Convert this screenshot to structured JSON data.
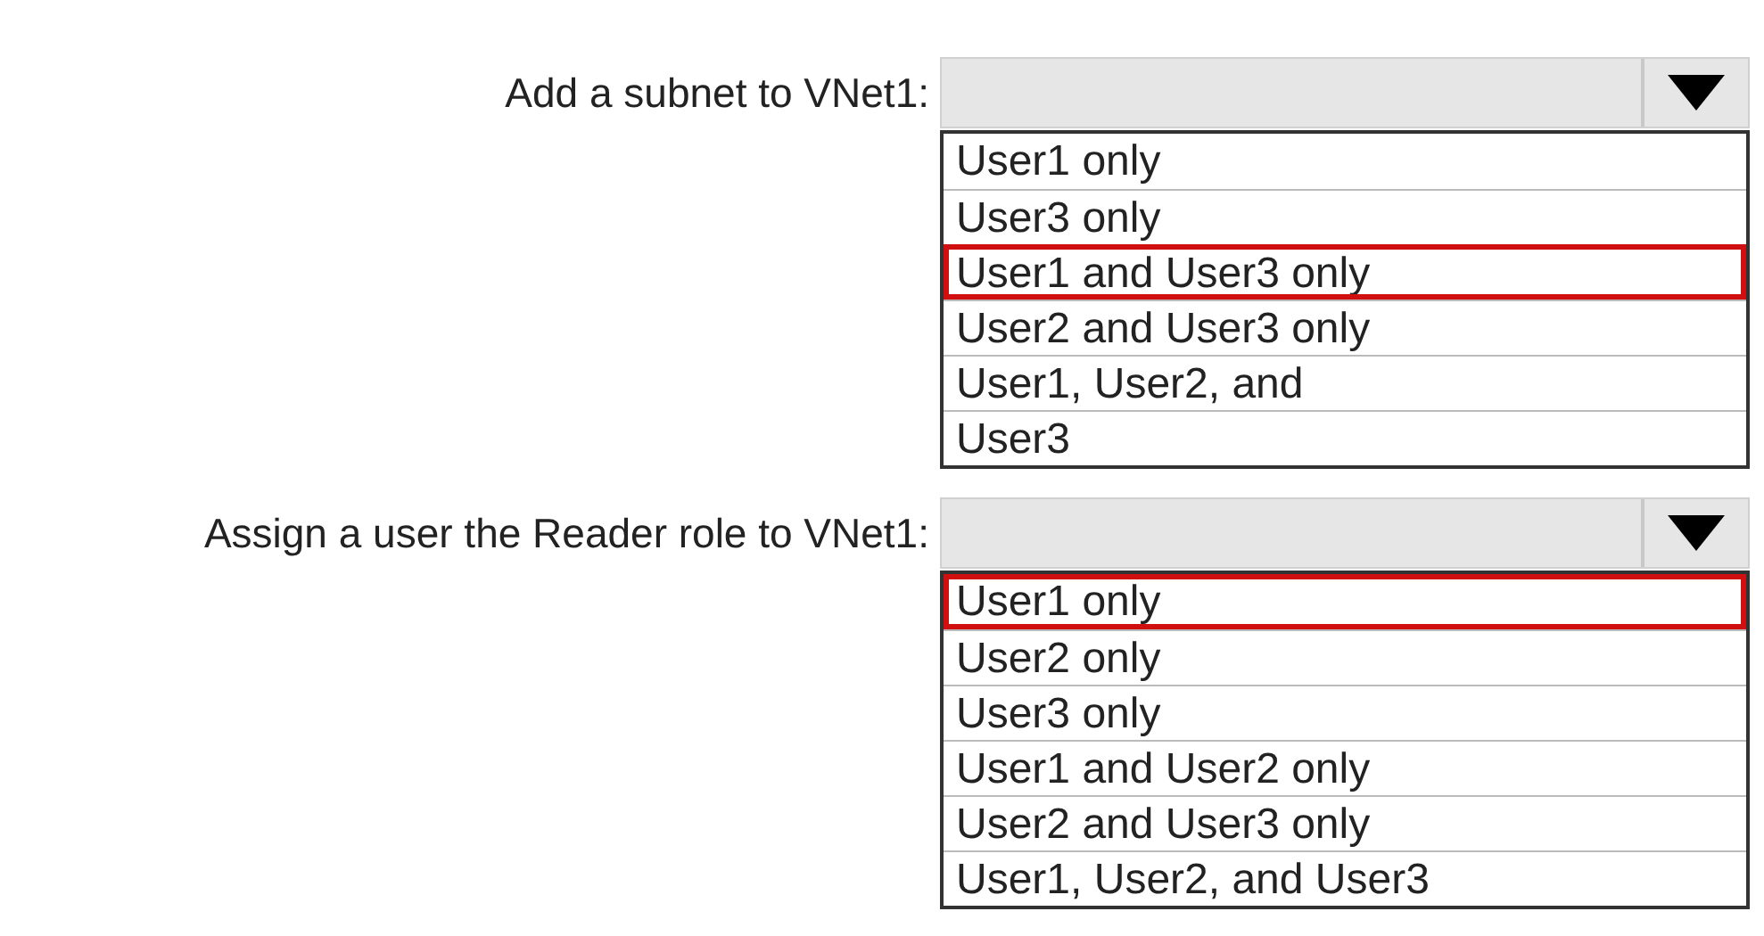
{
  "questions": [
    {
      "label": "Add a subnet to VNet1:",
      "options": [
        {
          "text": "User1 only",
          "selected": false
        },
        {
          "text": "User3 only",
          "selected": false
        },
        {
          "text": "User1 and User3 only",
          "selected": true
        },
        {
          "text": "User2 and User3 only",
          "selected": false
        },
        {
          "text": "User1, User2, and",
          "selected": false
        },
        {
          "text": "User3",
          "selected": false
        }
      ]
    },
    {
      "label": "Assign a user the Reader role to VNet1:",
      "options": [
        {
          "text": "User1 only",
          "selected": true
        },
        {
          "text": "User2 only",
          "selected": false
        },
        {
          "text": "User3 only",
          "selected": false
        },
        {
          "text": "User1 and User2 only",
          "selected": false
        },
        {
          "text": "User2 and User3 only",
          "selected": false
        },
        {
          "text": "User1, User2, and User3",
          "selected": false
        }
      ]
    }
  ]
}
